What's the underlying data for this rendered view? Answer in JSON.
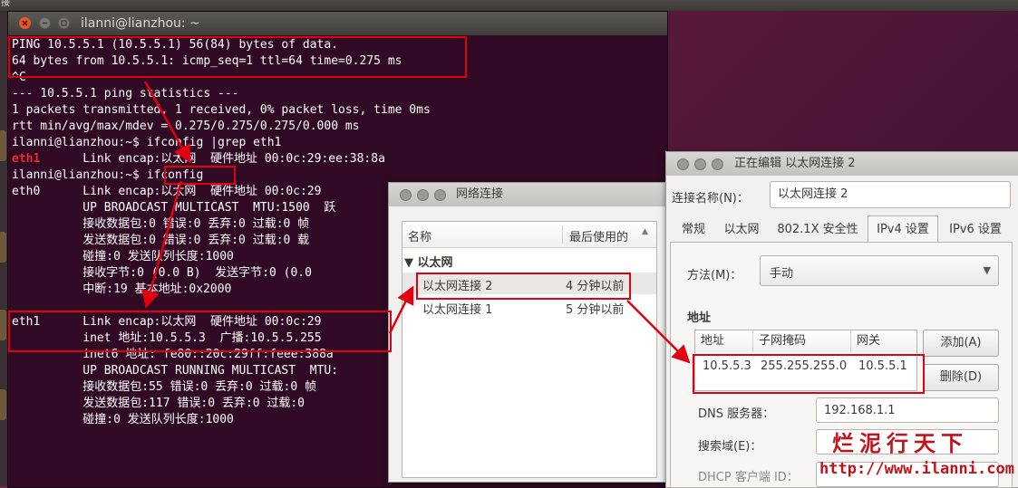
{
  "topbar": {
    "title": "接"
  },
  "terminal": {
    "title": "ilanni@lianzhou: ~",
    "lines": [
      {
        "text": "PING 10.5.5.1 (10.5.5.1) 56(84) bytes of data."
      },
      {
        "text": "64 bytes from 10.5.5.1: icmp_seq=1 ttl=64 time=0.275 ms"
      },
      {
        "text": "^C"
      },
      {
        "text": "--- 10.5.5.1 ping statistics ---"
      },
      {
        "text": "1 packets transmitted, 1 received, 0% packet loss, time 0ms"
      },
      {
        "text": "rtt min/avg/max/mdev = 0.275/0.275/0.275/0.000 ms"
      },
      {
        "text": "ilanni@lianzhou:~$ ifconfig |grep eth1"
      },
      {
        "prefix": "eth1",
        "text": "      Link encap:以太网  硬件地址 00:0c:29:ee:38:8a"
      },
      {
        "text": "ilanni@lianzhou:~$ ifconfig"
      },
      {
        "text": "eth0      Link encap:以太网  硬件地址 00:0c:29"
      },
      {
        "text": "          UP BROADCAST MULTICAST  MTU:1500  跃"
      },
      {
        "text": "          接收数据包:0 错误:0 丢弃:0 过载:0 帧"
      },
      {
        "text": "          发送数据包:0 错误:0 丢弃:0 过载:0 载"
      },
      {
        "text": "          碰撞:0 发送队列长度:1000"
      },
      {
        "text": "          接收字节:0 (0.0 B)  发送字节:0 (0.0"
      },
      {
        "text": "          中断:19 基本地址:0x2000"
      },
      {
        "text": ""
      },
      {
        "text": "eth1      Link encap:以太网  硬件地址 00:0c:29"
      },
      {
        "text": "          inet 地址:10.5.5.3  广播:10.5.5.255"
      },
      {
        "text": "          inet6 地址: fe80::20c:29ff:feee:388a"
      },
      {
        "text": "          UP BROADCAST RUNNING MULTICAST  MTU:"
      },
      {
        "text": "          接收数据包:55 错误:0 丢弃:0 过载:0 帧"
      },
      {
        "text": "          发送数据包:117 错误:0 丢弃:0 过载:0"
      },
      {
        "text": "          碰撞:0 发送队列长度:1000"
      }
    ]
  },
  "network_window": {
    "title": "网络连接",
    "col_name": "名称",
    "col_last_used": "最后使用的",
    "group": "以太网",
    "rows": [
      {
        "name": "以太网连接 2",
        "last_used": "4 分钟以前"
      },
      {
        "name": "以太网连接 1",
        "last_used": "5 分钟以前"
      }
    ]
  },
  "edit_window": {
    "title": "正在编辑 以太网连接 2",
    "conn_name_label": "连接名称(N)：",
    "conn_name_value": "以太网连接 2",
    "tabs": [
      "常规",
      "以太网",
      "802.1X 安全性",
      "IPv4 设置",
      "IPv6 设置"
    ],
    "active_tab": "IPv4 设置",
    "method_label": "方法(M)：",
    "method_value": "手动",
    "address_section": "地址",
    "table_headers": [
      "地址",
      "子网掩码",
      "网关"
    ],
    "address_row": [
      "10.5.5.3",
      "255.255.255.0",
      "10.5.5.1"
    ],
    "add_button": "添加(A)",
    "delete_button": "删除(D)",
    "dns_label": "DNS 服务器：",
    "dns_value": "192.168.1.1",
    "search_label": "搜索域(E)：",
    "search_value": "",
    "dhcp_label": "DHCP 客户端 ID："
  },
  "watermark": {
    "line1": "烂泥行天下",
    "line2": "http://www.ilanni.com"
  },
  "colors": {
    "terminal_bg": "#300a24",
    "highlight": "#e1000f",
    "close_button": "#e8552d"
  }
}
